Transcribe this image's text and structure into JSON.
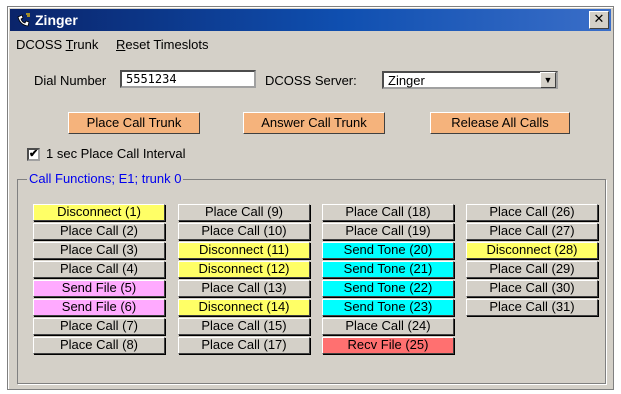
{
  "window": {
    "title": "Zinger",
    "close_label": "✕"
  },
  "menu": [
    {
      "label_pre": "DCOSS ",
      "label_u": "T",
      "label_post": "runk"
    },
    {
      "label_pre": "",
      "label_u": "R",
      "label_post": "eset Timeslots"
    }
  ],
  "dial": {
    "label": "Dial Number",
    "value": "5551234"
  },
  "server": {
    "label": "DCOSS Server:",
    "value": "Zinger"
  },
  "actions": {
    "place_call_trunk": "Place Call Trunk",
    "answer_call_trunk": "Answer Call Trunk",
    "release_all_calls": "Release All Calls"
  },
  "interval_checkbox": {
    "label": "1 sec Place Call Interval",
    "checked": true,
    "mark": "✔"
  },
  "group_label": "Call Functions; E1; trunk 0",
  "colors": {
    "default": "#d4d0c8",
    "disconnect": "#ffff66",
    "send_file": "#ffaaff",
    "send_tone": "#00ffff",
    "recv_file": "#ff7070",
    "action": "#f5b37c"
  },
  "columns": [
    [
      {
        "label": "Disconnect (1)",
        "state": "disconnect"
      },
      {
        "label": "Place Call (2)",
        "state": "default"
      },
      {
        "label": "Place Call (3)",
        "state": "default"
      },
      {
        "label": "Place Call (4)",
        "state": "default"
      },
      {
        "label": "Send File (5)",
        "state": "send_file"
      },
      {
        "label": "Send File (6)",
        "state": "send_file"
      },
      {
        "label": "Place Call (7)",
        "state": "default"
      },
      {
        "label": "Place Call (8)",
        "state": "default"
      }
    ],
    [
      {
        "label": "Place Call (9)",
        "state": "default"
      },
      {
        "label": "Place Call (10)",
        "state": "default"
      },
      {
        "label": "Disconnect (11)",
        "state": "disconnect"
      },
      {
        "label": "Disconnect (12)",
        "state": "disconnect"
      },
      {
        "label": "Place Call (13)",
        "state": "default"
      },
      {
        "label": "Disconnect (14)",
        "state": "disconnect"
      },
      {
        "label": "Place Call (15)",
        "state": "default"
      },
      {
        "label": "Place Call (17)",
        "state": "default"
      }
    ],
    [
      {
        "label": "Place Call (18)",
        "state": "default"
      },
      {
        "label": "Place Call (19)",
        "state": "default"
      },
      {
        "label": "Send Tone (20)",
        "state": "send_tone"
      },
      {
        "label": "Send Tone (21)",
        "state": "send_tone"
      },
      {
        "label": "Send Tone (22)",
        "state": "send_tone"
      },
      {
        "label": "Send Tone (23)",
        "state": "send_tone"
      },
      {
        "label": "Place Call (24)",
        "state": "default"
      },
      {
        "label": "Recv File (25)",
        "state": "recv_file"
      }
    ],
    [
      {
        "label": "Place Call (26)",
        "state": "default"
      },
      {
        "label": "Place Call (27)",
        "state": "default"
      },
      {
        "label": "Disconnect (28)",
        "state": "disconnect"
      },
      {
        "label": "Place Call (29)",
        "state": "default"
      },
      {
        "label": "Place Call (30)",
        "state": "default"
      },
      {
        "label": "Place Call (31)",
        "state": "default"
      }
    ]
  ]
}
